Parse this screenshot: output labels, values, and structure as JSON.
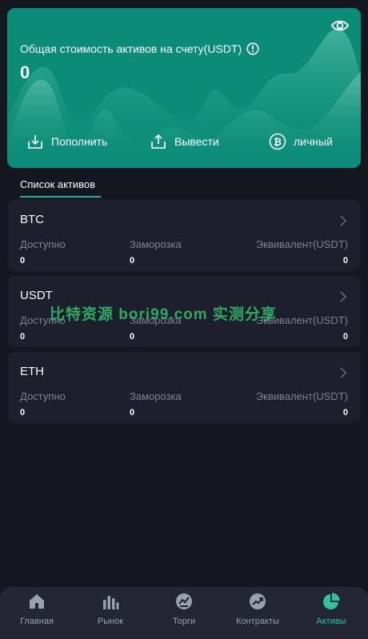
{
  "hero": {
    "title": "Общая стоимость активов на счету(USDT)",
    "value": "0",
    "actions": [
      {
        "label": "Пополнить",
        "icon": "deposit-icon"
      },
      {
        "label": "Вывести",
        "icon": "withdraw-icon"
      },
      {
        "label": "личный",
        "icon": "bitcoin-icon"
      }
    ]
  },
  "tabs": {
    "active": "Список активов"
  },
  "assets": [
    {
      "name": "BTC",
      "available_label": "Доступно",
      "frozen_label": "Заморозка",
      "equiv_label": "Эквивалент(USDT)",
      "available": "0",
      "frozen": "0",
      "equiv": "0"
    },
    {
      "name": "USDT",
      "available_label": "Доступно",
      "frozen_label": "Заморозка",
      "equiv_label": "Эквивалент(USDT)",
      "available": "0",
      "frozen": "0",
      "equiv": "0"
    },
    {
      "name": "ETH",
      "available_label": "Доступно",
      "frozen_label": "Заморозка",
      "equiv_label": "Эквивалент(USDT)",
      "available": "0",
      "frozen": "0",
      "equiv": "0"
    }
  ],
  "watermark": "比特资源 bori99.com 实测分享",
  "nav": [
    {
      "label": "Главная",
      "icon": "home-icon",
      "active": false
    },
    {
      "label": "Рынок",
      "icon": "bar-chart-icon",
      "active": false
    },
    {
      "label": "Торги",
      "icon": "trade-icon",
      "active": false
    },
    {
      "label": "Контракты",
      "icon": "trend-icon",
      "active": false
    },
    {
      "label": "Активы",
      "icon": "pie-chart-icon",
      "active": true
    }
  ],
  "colors": {
    "accent": "#17b496",
    "hero_bg": "#0a8c78",
    "page_bg": "#141620",
    "card_bg": "#1d202c",
    "muted": "#7d8190"
  }
}
